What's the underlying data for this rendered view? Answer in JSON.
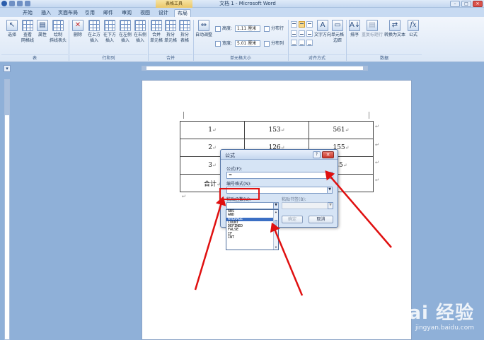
{
  "window": {
    "title": "文档 1 - Microsoft Word",
    "context_tab": "表格工具"
  },
  "tabs": [
    "开始",
    "插入",
    "页面布局",
    "引用",
    "邮件",
    "审阅",
    "视图",
    "设计",
    "布局"
  ],
  "active_tab": "布局",
  "ribbon": {
    "groups": {
      "table": "表",
      "rows_cols": "行和列",
      "merge": "合并",
      "cell_size": "单元格大小",
      "alignment": "对齐方式",
      "data": "数据"
    },
    "buttons": {
      "select": "选择",
      "gridlines": "查看\n网格线",
      "properties": "属性",
      "draw_diagonal": "绘制\n斜线表头",
      "delete": "删除",
      "insert_above": "在上方\n插入",
      "insert_below": "在下方\n插入",
      "insert_left": "在左侧\n插入",
      "insert_right": "在右侧\n插入",
      "merge_cells": "合并\n单元格",
      "split_cells": "拆分\n单元格",
      "split_table": "拆分\n表格",
      "autofit": "自动调整",
      "text_direction": "文字方向",
      "cell_margins": "单元格\n边距",
      "sort": "排序",
      "repeat_header": "重复标题行",
      "convert_to_text": "转换为文本",
      "formula": "公式"
    },
    "height_label": "高度:",
    "height_value": "1.11 厘米",
    "width_label": "宽度:",
    "width_value": "5.01 厘米",
    "distribute_rows": "分布行",
    "distribute_cols": "分布列"
  },
  "table": [
    [
      "1",
      "153",
      "561"
    ],
    [
      "2",
      "126",
      "155"
    ],
    [
      "3",
      "",
      "25"
    ],
    [
      "合计",
      "",
      ""
    ]
  ],
  "dialog": {
    "title": "公式",
    "help": "?",
    "close": "✕",
    "formula_label": "公式(F):",
    "formula_value": "=",
    "number_format_label": "编号格式(N):",
    "paste_function_label": "粘贴函数(U):",
    "paste_bookmark_label": "粘贴书签(B):",
    "ok": "确定",
    "cancel": "取消"
  },
  "function_list": [
    "ABS",
    "AND",
    "AVERAGE",
    "COUNT",
    "DEFINED",
    "FALSE",
    "IF",
    "INT"
  ],
  "selected_function": "AVERAGE",
  "watermark": {
    "brand": "Bai 经验",
    "url": "jingyan.baidu.com"
  },
  "colors": {
    "arrow": "#e01010",
    "selection": "#3b6fc4"
  }
}
